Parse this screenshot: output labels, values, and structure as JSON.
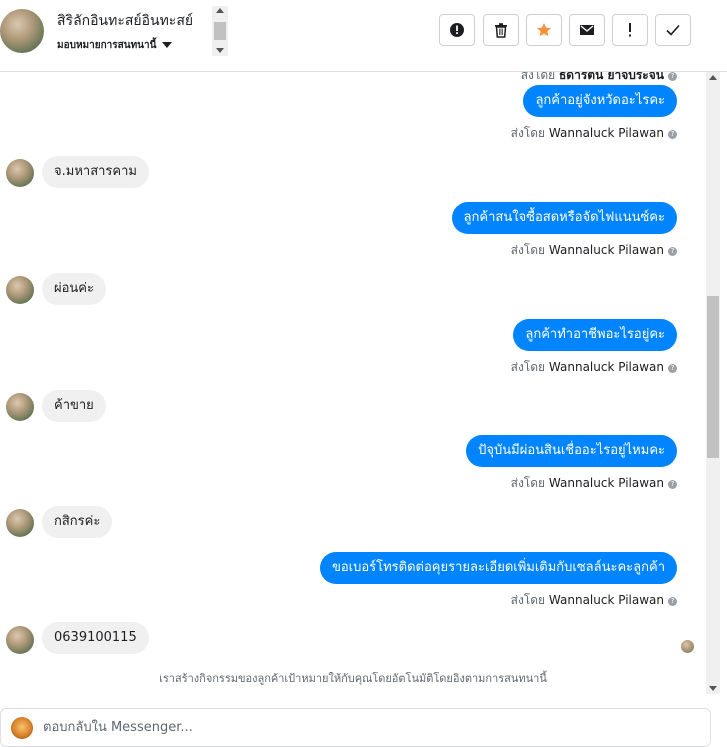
{
  "header": {
    "contact_name": "สิริลักอินทะสย์อินทะสย์",
    "assignment_label": "มอบหมายการสนทนานี้",
    "buttons": [
      {
        "name": "spam-button",
        "icon": "exclamation-circle-icon"
      },
      {
        "name": "delete-button",
        "icon": "trash-icon"
      },
      {
        "name": "star-button",
        "icon": "star-icon"
      },
      {
        "name": "mark-unread-button",
        "icon": "envelope-icon"
      },
      {
        "name": "follow-up-button",
        "icon": "exclamation-icon"
      },
      {
        "name": "mark-done-button",
        "icon": "checkmark-icon"
      }
    ]
  },
  "messages": {
    "top_partial_sender_prefix": "ส่งโดย",
    "top_partial_sender_name": "ธิดารัตน์ ยาจิบระจัน",
    "outgoing": [
      {
        "text": "ลูกค้าอยู่จังหวัดอะไรคะ",
        "sent_by_prefix": "ส่งโดย",
        "sent_by_name": "Wannaluck Pilawan"
      },
      {
        "text": "ลูกค้าสนใจซื้อสดหรือจัดไฟแนนซ์คะ",
        "sent_by_prefix": "ส่งโดย",
        "sent_by_name": "Wannaluck Pilawan"
      },
      {
        "text": "ลูกค้าทำอาชีพอะไรอยู่คะ",
        "sent_by_prefix": "ส่งโดย",
        "sent_by_name": "Wannaluck Pilawan"
      },
      {
        "text": "ปัจุบันมีผ่อนสินเชื่ออะไรอยู่ไหมคะ",
        "sent_by_prefix": "ส่งโดย",
        "sent_by_name": "Wannaluck Pilawan"
      },
      {
        "text": "ขอเบอร์โทรติดต่อคุยรายละเอียดเพิ่มเติมกับเซลล์นะคะลูกค้า",
        "sent_by_prefix": "ส่งโดย",
        "sent_by_name": "Wannaluck Pilawan"
      }
    ],
    "incoming": [
      {
        "text": "จ.มหาสารคาม"
      },
      {
        "text": "ผ่อนค่ะ"
      },
      {
        "text": "ค้าขาย"
      },
      {
        "text": "กสิกรค่ะ"
      },
      {
        "text": "0639100115"
      }
    ],
    "notice": "เราสร้างกิจกรรมของลูกค้าเป้าหมายให้กับคุณโดยอัตโนมัติโดยอิงตามการสนทนานี้"
  },
  "composer": {
    "placeholder": "ตอบกลับใน Messenger..."
  },
  "colors": {
    "outgoing_bubble": "#0084ff",
    "incoming_bubble": "#f1f0f0",
    "star": "#f7923b"
  }
}
